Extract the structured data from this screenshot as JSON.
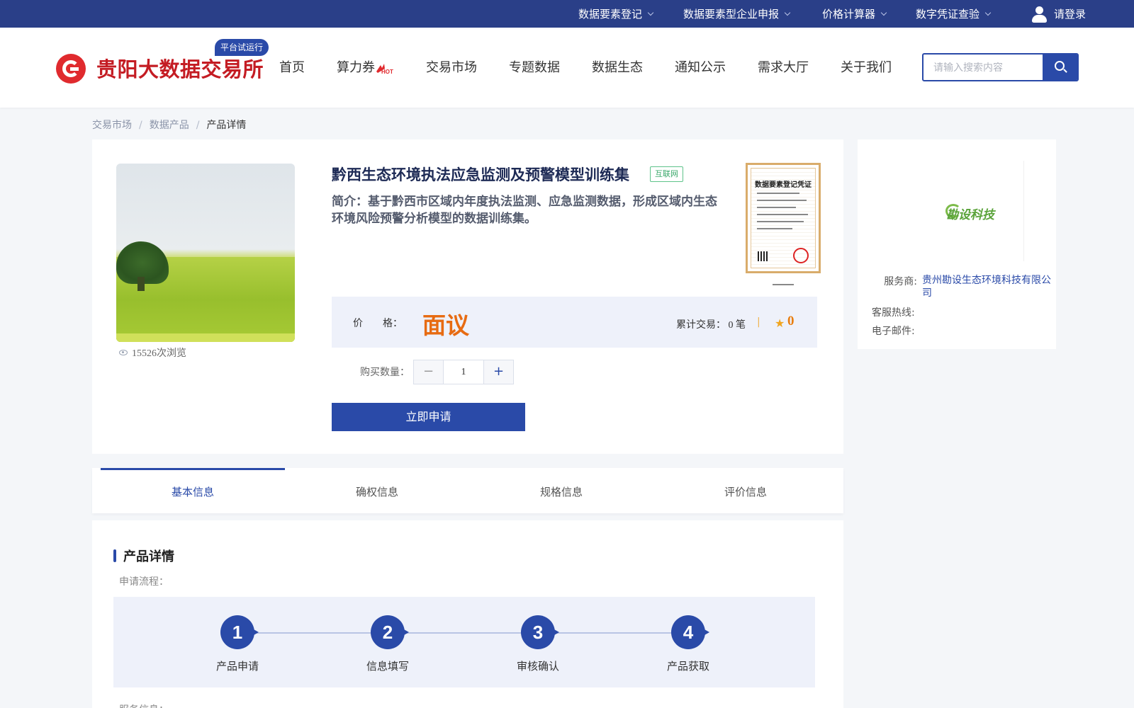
{
  "topbar": {
    "items": [
      "数据要素登记",
      "数据要素型企业申报",
      "价格计算器",
      "数字凭证查验"
    ],
    "login": "请登录"
  },
  "header": {
    "logo_text": "贵阳大数据交易所",
    "beta_badge": "平台试运行",
    "nav": [
      "首页",
      "算力券",
      "交易市场",
      "专题数据",
      "数据生态",
      "通知公示",
      "需求大厅",
      "关于我们"
    ],
    "hot_badge": "HOT",
    "search_placeholder": "请输入搜索内容"
  },
  "breadcrumb": [
    "交易市场",
    "数据产品",
    "产品详情"
  ],
  "product": {
    "views": "15526次浏览",
    "title": "黔西生态环境执法应急监测及预警模型训练集",
    "tag": "互联网",
    "intro": "简介：基于黔西市区域内年度执法监测、应急监测数据，形成区域内生态环境风险预警分析模型的数据训练集。",
    "certificate_title": "数据要素登记凭证",
    "price_label_a": "价",
    "price_label_b": "格：",
    "price": "面议",
    "trade_count": "累计交易： 0 笔",
    "trade_sep": "|",
    "rating": "0",
    "qty_label": "购买数量：",
    "qty_value": "1",
    "minus": "−",
    "plus": "+",
    "apply_button": "立即申请"
  },
  "side": {
    "company_logo_text": "勘设科技",
    "provider_label": "服务商:",
    "provider_name": "贵州勘设生态环境科技有限公司",
    "hotline_label": "客服热线:",
    "email_label": "电子邮件:"
  },
  "tabs": [
    "基本信息",
    "确权信息",
    "规格信息",
    "评价信息"
  ],
  "detail": {
    "title": "产品详情",
    "flow_label": "申请流程：",
    "steps": [
      {
        "num": "1",
        "label": "产品申请"
      },
      {
        "num": "2",
        "label": "信息填写"
      },
      {
        "num": "3",
        "label": "审核确认"
      },
      {
        "num": "4",
        "label": "产品获取"
      }
    ],
    "service_label": "服务信息："
  },
  "colors": {
    "primary": "#2a4aa8",
    "topbar": "#2a3f88",
    "logo_red": "#e02a2e",
    "price_orange": "#e76b12"
  }
}
